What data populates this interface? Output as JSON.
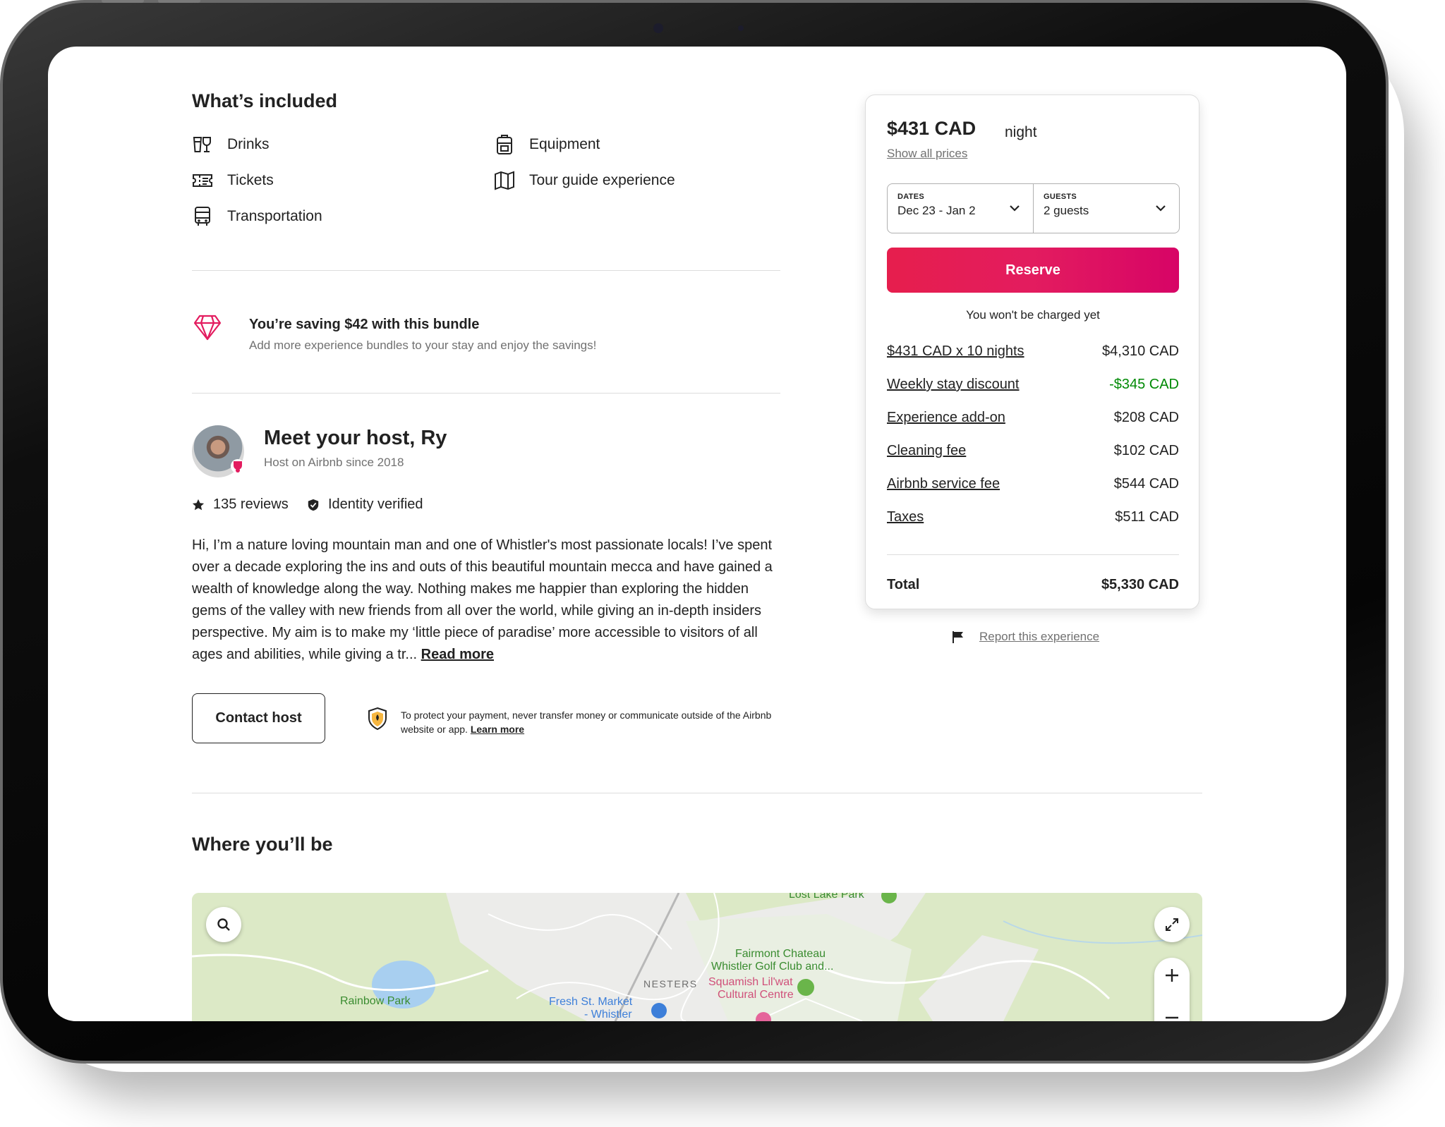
{
  "included": {
    "heading": "What’s included",
    "items": [
      {
        "label": "Drinks",
        "icon": "drinks-icon"
      },
      {
        "label": "Tickets",
        "icon": "ticket-icon"
      },
      {
        "label": "Transportation",
        "icon": "bus-icon"
      },
      {
        "label": "Equipment",
        "icon": "backpack-icon"
      },
      {
        "label": "Tour guide experience",
        "icon": "map-icon"
      }
    ]
  },
  "bundle": {
    "title": "You’re saving $42 with this bundle",
    "subtitle": "Add more experience bundles to your stay and enjoy the savings!",
    "accent": "#e31c5f"
  },
  "host": {
    "heading": "Meet your host, Ry",
    "since": "Host on Airbnb since 2018",
    "reviews": "135 reviews",
    "verified": "Identity verified",
    "bio": "Hi, I’m a nature loving mountain man and one of Whistler's most passionate locals! I’ve spent over a decade exploring the ins and outs of this beautiful mountain mecca and have gained a wealth of knowledge along the way. Nothing makes me happier than exploring the hidden gems of the valley with new friends from all over the world, while giving an in-depth insiders perspective. My aim is to make my ‘little piece of paradise’ more accessible to visitors of all ages and abilities, while giving a tr...",
    "read_more": "Read more",
    "contact_label": "Contact host",
    "protect_text": "To protect your payment, never transfer money or communicate outside of the Airbnb website or app.",
    "learn_more": "Learn more"
  },
  "booking": {
    "price": "$431 CAD",
    "unit": "night",
    "show_prices": "Show all prices",
    "dates_label": "DATES",
    "dates_value": "Dec 23 - Jan 2",
    "guests_label": "GUESTS",
    "guests_value": "2 guests",
    "reserve_label": "Reserve",
    "no_charge": "You won't be charged yet",
    "fees": [
      {
        "label": "$431 CAD x 10 nights",
        "value": "$4,310 CAD"
      },
      {
        "label": "Weekly stay discount",
        "value": "-$345 CAD"
      },
      {
        "label": "Experience add-on",
        "value": "$208 CAD"
      },
      {
        "label": "Cleaning fee",
        "value": "$102 CAD"
      },
      {
        "label": "Airbnb service fee",
        "value": "$544 CAD"
      },
      {
        "label": "Taxes",
        "value": "$511 CAD"
      }
    ],
    "total_label": "Total",
    "total_value": "$5,330 CAD",
    "report": "Report this experience",
    "brand_color": "#e31c5f",
    "discount_color": "#008a05"
  },
  "location": {
    "heading": "Where you’ll be",
    "labels": {
      "lost_lake": "Lost Lake Park",
      "fairmont_1": "Fairmont Chateau",
      "fairmont_2": "Whistler Golf Club and...",
      "nesters": "NESTERS",
      "squamish_1": "Squamish Lil'wat",
      "squamish_2": "Cultural Centre",
      "rainbow": "Rainbow Park",
      "fresh_1": "Fresh St. Market",
      "fresh_2": "- Whistler"
    }
  }
}
